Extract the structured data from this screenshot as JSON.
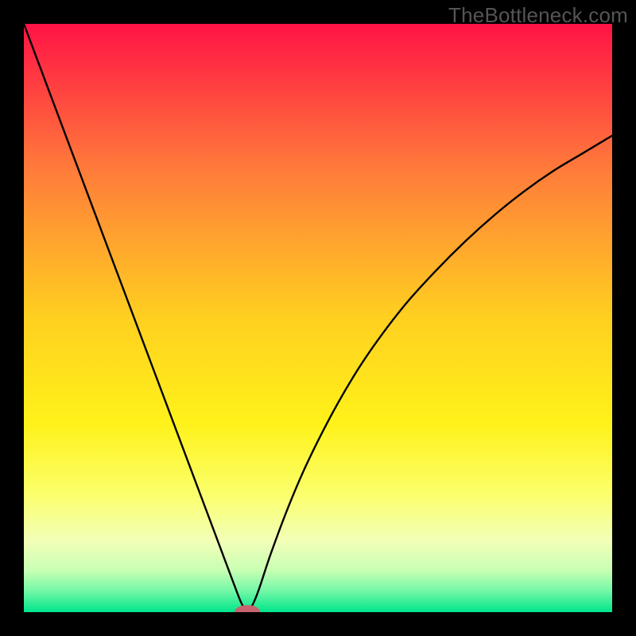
{
  "watermark": "TheBottleneck.com",
  "chart_data": {
    "type": "line",
    "title": "",
    "xlabel": "",
    "ylabel": "",
    "xlim": [
      0,
      100
    ],
    "ylim": [
      0,
      100
    ],
    "series": [
      {
        "name": "curve",
        "x": [
          0,
          3,
          6,
          9,
          12,
          15,
          18,
          21,
          24,
          27,
          30,
          33,
          36,
          37,
          38,
          39,
          40,
          42,
          45,
          48,
          52,
          56,
          60,
          65,
          70,
          75,
          80,
          85,
          90,
          95,
          100
        ],
        "values": [
          100,
          92,
          84,
          76,
          68,
          60,
          52,
          44,
          36,
          28,
          20,
          12,
          4,
          1.5,
          0,
          1.5,
          4,
          10,
          18,
          25,
          33,
          40,
          46,
          52.5,
          58,
          63,
          67.5,
          71.5,
          75,
          78,
          81
        ]
      }
    ],
    "marker": {
      "x": 38,
      "y": 0,
      "rx": 2.2,
      "ry": 1.2,
      "color": "#c9636f"
    },
    "gradient_stops": [
      {
        "offset": 0.0,
        "color": "#ff1346"
      },
      {
        "offset": 0.25,
        "color": "#ff7c3a"
      },
      {
        "offset": 0.5,
        "color": "#ffd020"
      },
      {
        "offset": 0.68,
        "color": "#fff21a"
      },
      {
        "offset": 0.8,
        "color": "#fbff6c"
      },
      {
        "offset": 0.88,
        "color": "#f2ffb8"
      },
      {
        "offset": 0.93,
        "color": "#c7ffb3"
      },
      {
        "offset": 0.965,
        "color": "#70f7a6"
      },
      {
        "offset": 1.0,
        "color": "#00e58c"
      }
    ]
  }
}
